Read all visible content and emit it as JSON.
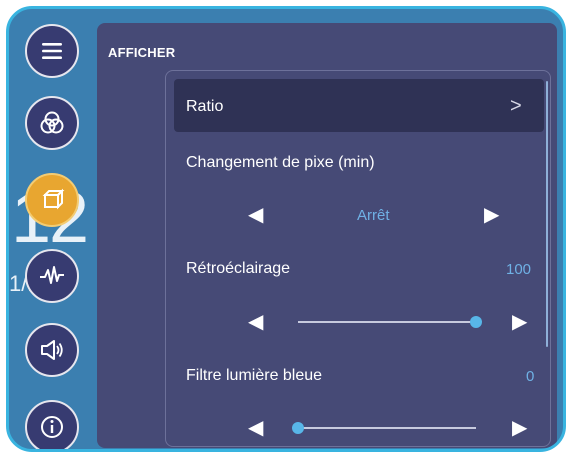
{
  "background_text": {
    "big": "12",
    "small": "1/10"
  },
  "rail": {
    "items": [
      {
        "name": "menu",
        "active": false
      },
      {
        "name": "color",
        "active": false
      },
      {
        "name": "display",
        "active": true
      },
      {
        "name": "signal",
        "active": false
      },
      {
        "name": "sound",
        "active": false
      },
      {
        "name": "info",
        "active": false
      }
    ]
  },
  "panel": {
    "title": "AFFICHER",
    "ratio": {
      "label": "Ratio",
      "chevron": ">"
    },
    "pixel_shift": {
      "label": "Changement de pixe (min)",
      "value": "Arrêt"
    },
    "backlight": {
      "label": "Rétroéclairage",
      "value": "100",
      "level": 1.0
    },
    "blue_filter": {
      "label": "Filtre lumière bleue",
      "value": "0",
      "level": 0.0
    },
    "arrows": {
      "left": "◀",
      "right": "▶"
    }
  }
}
